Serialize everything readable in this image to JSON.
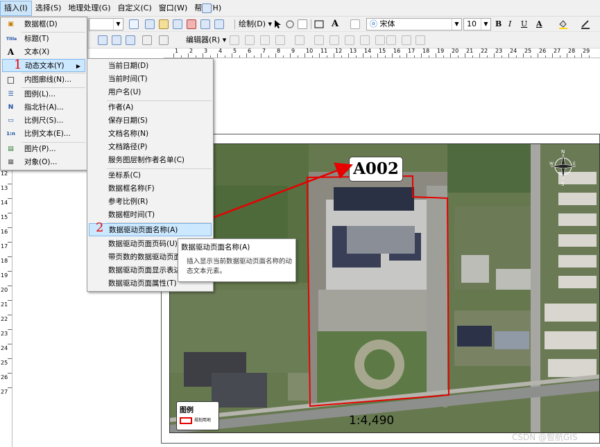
{
  "menubar": {
    "items": [
      "插入(I)",
      "选择(S)",
      "地理处理(G)",
      "自定义(C)",
      "窗口(W)",
      "帮助(H)"
    ]
  },
  "toolbar": {
    "draw_label": "绘制(D)",
    "font_name": "宋体",
    "font_size": "10",
    "bold": "B",
    "italic": "I",
    "underline": "U",
    "text_color": "A",
    "text_tool": "A",
    "editor_label": "编辑器(R)"
  },
  "insert_menu": {
    "items": [
      {
        "label": "数据框(D)",
        "icon": "data-frame-icon",
        "glyph": "▣"
      },
      {
        "label": "标题(T)",
        "icon": "title-icon",
        "glyph": "Title"
      },
      {
        "label": "文本(X)",
        "icon": "text-icon",
        "glyph": "A"
      },
      {
        "label": "动态文本(Y)",
        "icon": "dynamic-text-icon",
        "glyph": ""
      },
      {
        "label": "内图廓线(N)...",
        "icon": "neatline-icon",
        "glyph": "□"
      },
      {
        "label": "图例(L)...",
        "icon": "legend-icon",
        "glyph": "☰"
      },
      {
        "label": "指北针(A)...",
        "icon": "north-arrow-icon",
        "glyph": "N"
      },
      {
        "label": "比例尺(S)...",
        "icon": "scale-bar-icon",
        "glyph": "▭"
      },
      {
        "label": "比例文本(E)...",
        "icon": "scale-text-icon",
        "glyph": "1:n"
      },
      {
        "label": "图片(P)...",
        "icon": "picture-icon",
        "glyph": "▤"
      },
      {
        "label": "对象(O)...",
        "icon": "object-icon",
        "glyph": "▦"
      }
    ]
  },
  "dynamic_text_menu": {
    "items": [
      "当前日期(D)",
      "当前时间(T)",
      "用户名(U)",
      "作者(A)",
      "保存日期(S)",
      "文档名称(N)",
      "文档路径(P)",
      "服务图层制作者名单(C)",
      "坐标系(C)",
      "数据框名称(F)",
      "参考比例(R)",
      "数据框时间(T)",
      "数据驱动页面名称(A)",
      "数据驱动页面页码(U)",
      "带页数的数据驱动页面",
      "数据驱动页面显示表达",
      "数据驱动页面属性(T)"
    ]
  },
  "steps": {
    "one": "1",
    "two": "2"
  },
  "tooltip": {
    "title": "数据驱动页面名称(A)",
    "body": "插入显示当前数据驱动页面名称的动态文本元素。"
  },
  "map": {
    "page_name": "A002",
    "scale_text": "1:4,490",
    "legend_title": "图例",
    "legend_item": "规划用地",
    "north_n": "N",
    "north_s": "S",
    "north_e": "E",
    "north_w": "W"
  },
  "ruler": {
    "h_labels": [
      "1",
      "2",
      "3",
      "4",
      "5",
      "6",
      "7",
      "8",
      "9",
      "10",
      "11",
      "12",
      "13",
      "14",
      "15",
      "16",
      "17",
      "18",
      "19",
      "20",
      "21",
      "22",
      "23",
      "24",
      "25",
      "26",
      "27",
      "28",
      "29"
    ],
    "v_labels": [
      "12",
      "13",
      "14",
      "15",
      "16",
      "17",
      "18",
      "19",
      "20",
      "21",
      "22",
      "23",
      "24",
      "25",
      "26",
      "27"
    ]
  },
  "watermark": "CSDN @智航GIS",
  "colors": {
    "highlight": "#cce8ff",
    "red": "#e60000",
    "menu_bg": "#f2f2f2"
  }
}
